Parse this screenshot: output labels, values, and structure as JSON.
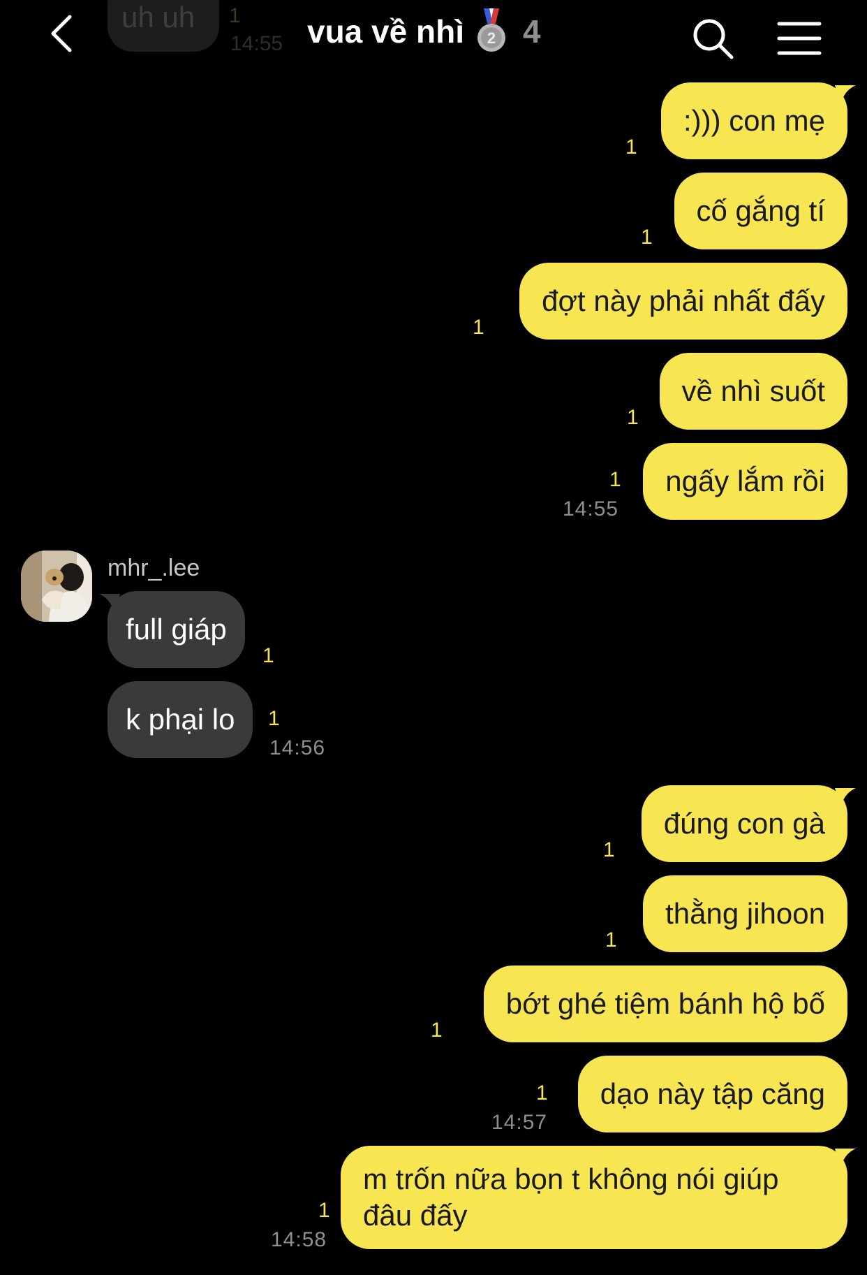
{
  "header": {
    "title": "vua về nhì",
    "member_count": "4"
  },
  "previous_message": {
    "text": "uh uh",
    "unread": "1",
    "time": "14:55"
  },
  "conversation": {
    "block1": [
      {
        "text": ":))) con mẹ",
        "unread": "1"
      },
      {
        "text": "cố gắng tí",
        "unread": "1"
      },
      {
        "text": "đợt này phải nhất đấy",
        "unread": "1"
      },
      {
        "text": "về nhì suốt",
        "unread": "1"
      },
      {
        "text": "ngấy lắm rồi",
        "unread": "1",
        "time": "14:55"
      }
    ],
    "sender": {
      "name": "mhr_.lee"
    },
    "block2": [
      {
        "text": "full giáp",
        "unread": "1"
      },
      {
        "text": "k phại lo",
        "unread": "1",
        "time": "14:56"
      }
    ],
    "block3": [
      {
        "text": "đúng con gà",
        "unread": "1"
      },
      {
        "text": "thằng jihoon",
        "unread": "1"
      },
      {
        "text": "bớt ghé tiệm bánh hộ bố",
        "unread": "1"
      },
      {
        "text": "dạo này tập căng",
        "unread": "1",
        "time": "14:57"
      },
      {
        "text": "m trốn nữa bọn t không nói giúp đâu đấy",
        "unread": "1",
        "time": "14:58"
      }
    ]
  },
  "icons": {
    "back": "chevron-left-icon",
    "medal": "silver-medal-icon",
    "search": "search-icon",
    "menu": "hamburger-menu-icon"
  },
  "colors": {
    "background": "#000000",
    "my_bubble": "#f7e551",
    "their_bubble": "#3a3a3c",
    "unread_count": "#f7e551",
    "timestamp": "#8e8e93"
  }
}
